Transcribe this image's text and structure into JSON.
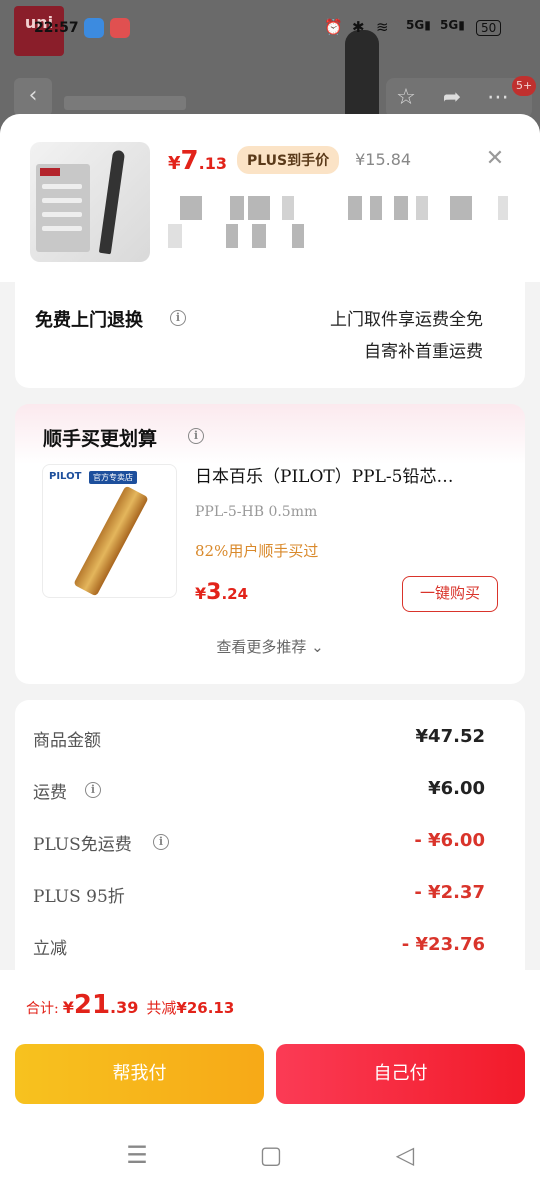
{
  "status_bar": {
    "time": "22:57",
    "battery": "50"
  },
  "background": {
    "logo": "uni",
    "cart_badge": "5+"
  },
  "product": {
    "price_currency": "¥",
    "price_int": "7",
    "price_dec": ".13",
    "plus_tag": "PLUS到手价",
    "original_price": "¥15.84",
    "close_icon": "close-icon"
  },
  "return_service": {
    "title": "免费上门退换",
    "desc_line1": "上门取件享运费全免",
    "desc_line2": "自寄补首重运费"
  },
  "recommend": {
    "title": "顺手买更划算",
    "item": {
      "brand": "PILOT",
      "store_tag": "官方专卖店",
      "name": "日本百乐（PILOT）PPL-5铅芯…",
      "spec": "PPL-5-HB 0.5mm",
      "buyers": "82%用户顺手买过",
      "price_currency": "¥",
      "price_int": "3",
      "price_dec": ".24",
      "buy_label": "一键购买"
    },
    "more_label": "查看更多推荐"
  },
  "summary": {
    "rows": [
      {
        "label": "商品金额",
        "value": "¥47.52"
      },
      {
        "label": "运费",
        "value": "¥6.00"
      },
      {
        "label": "PLUS免运费",
        "value": "- ¥6.00"
      },
      {
        "label": "PLUS 95折",
        "value": "- ¥2.37"
      },
      {
        "label": "立减",
        "value": "- ¥23.76"
      }
    ]
  },
  "checkout": {
    "total_label": "合计:",
    "total_currency": "¥",
    "total_int": "21",
    "total_dec": ".39",
    "discount_label": "共减",
    "discount_amount": "¥26.13",
    "help_pay": "帮我付",
    "self_pay": "自己付"
  },
  "colors": {
    "accent_red": "#e2231a",
    "help_yellow": "#f7b51b",
    "self_red": "#f52a3a"
  }
}
